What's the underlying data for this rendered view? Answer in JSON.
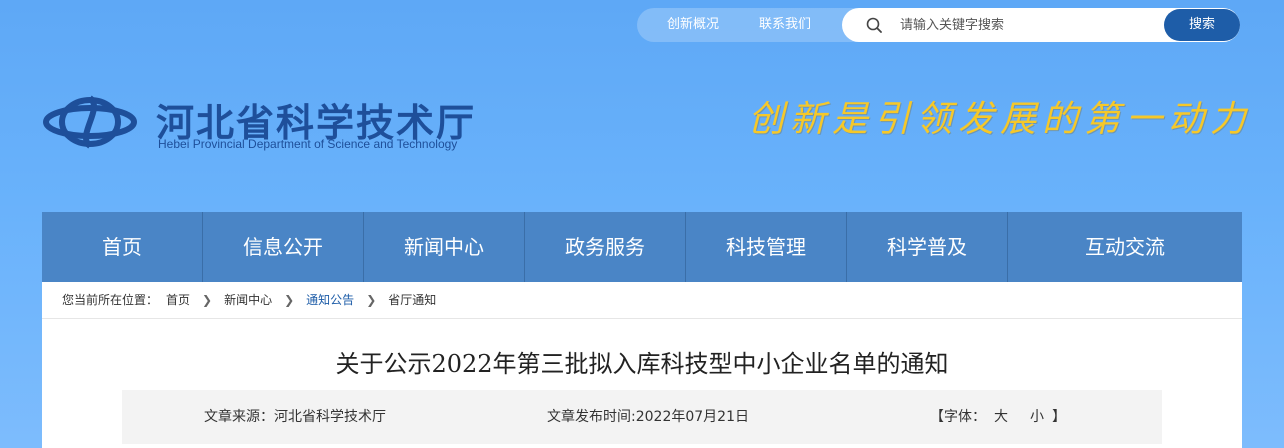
{
  "top_links": {
    "innovation": "创新概况",
    "contact": "联系我们"
  },
  "search": {
    "placeholder": "请输入关键字搜索",
    "button_label": "搜索"
  },
  "logo": {
    "title": "河北省科学技术厅",
    "subtitle": "Hebei Provincial Department of Science and Technology"
  },
  "slogan": "创新是引领发展的第一动力",
  "nav": {
    "items": [
      "首页",
      "信息公开",
      "新闻中心",
      "政务服务",
      "科技管理",
      "科学普及",
      "互动交流"
    ]
  },
  "breadcrumb": {
    "prefix": "您当前所在位置：",
    "items": [
      "首页",
      "新闻中心",
      "通知公告",
      "省厅通知"
    ]
  },
  "article": {
    "title": "关于公示2022年第三批拟入库科技型中小企业名单的通知",
    "source_label": "文章来源：",
    "source": "河北省科学技术厅",
    "date_label": "文章发布时间:",
    "date": "2022年07月21日",
    "font_label": "【字体：",
    "font_large": "大",
    "font_small": "小",
    "font_close": "】"
  },
  "colors": {
    "brand_blue": "#1e4f9a",
    "nav_blue": "#4a85c6",
    "slogan_gold": "#f6c829"
  }
}
